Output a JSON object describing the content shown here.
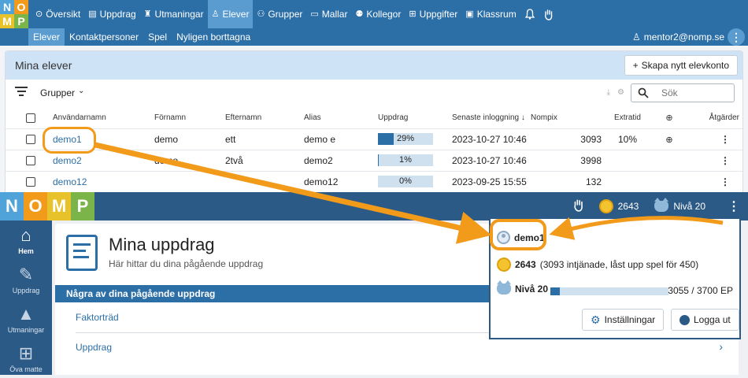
{
  "teacher": {
    "logo_letters": [
      "N",
      "O",
      "M",
      "P"
    ],
    "nav": [
      {
        "label": "Översikt",
        "icon": "compass-icon",
        "glyph": "⊙"
      },
      {
        "label": "Uppdrag",
        "icon": "book-icon",
        "glyph": "▤"
      },
      {
        "label": "Utmaningar",
        "icon": "trophy-icon",
        "glyph": "♜"
      },
      {
        "label": "Elever",
        "icon": "person-icon",
        "glyph": "♙"
      },
      {
        "label": "Grupper",
        "icon": "group-icon",
        "glyph": "⚇"
      },
      {
        "label": "Mallar",
        "icon": "folder-icon",
        "glyph": "▭"
      },
      {
        "label": "Kollegor",
        "icon": "colleagues-icon",
        "glyph": "⚉"
      },
      {
        "label": "Uppgifter",
        "icon": "grid-icon",
        "glyph": "⊞"
      },
      {
        "label": "Klassrum",
        "icon": "classroom-icon",
        "glyph": "▣"
      }
    ],
    "subnav": [
      "Elever",
      "Kontaktpersoner",
      "Spel",
      "Nyligen borttagna"
    ],
    "user_email": "mentor2@nomp.se",
    "card_title": "Mina elever",
    "create_button": "Skapa nytt elevkonto",
    "groups_label": "Grupper",
    "search_placeholder": "Sök",
    "columns": [
      "Användarnamn",
      "Förnamn",
      "Efternamn",
      "Alias",
      "Uppdrag",
      "Senaste inloggning",
      "Nompix",
      "Extratid",
      "Åtgärder"
    ],
    "rows": [
      {
        "username": "demo1",
        "first": "demo",
        "last": "ett",
        "alias": "demo e",
        "progress": "29%",
        "progress_value": 29,
        "login": "2023-10-27 10:46",
        "nompix": "3093",
        "extratid": "10%",
        "globe": true
      },
      {
        "username": "demo2",
        "first": "demo",
        "last": "2två",
        "alias": "demo2",
        "progress": "1%",
        "progress_value": 1,
        "login": "2023-10-27 10:46",
        "nompix": "3998",
        "extratid": "",
        "globe": false
      },
      {
        "username": "demo12",
        "first": "",
        "last": "",
        "alias": "demo12",
        "progress": "0%",
        "progress_value": 0,
        "login": "2023-09-25 15:55",
        "nompix": "132",
        "extratid": "",
        "globe": false
      }
    ]
  },
  "student": {
    "logo_letters": [
      "N",
      "O",
      "M",
      "P"
    ],
    "coins": "2643",
    "level": "Nivå 20",
    "sidebar": [
      {
        "label": "Hem",
        "icon": "home-icon",
        "glyph": "⌂"
      },
      {
        "label": "Uppdrag",
        "icon": "assignment-icon",
        "glyph": "✎"
      },
      {
        "label": "Utmaningar",
        "icon": "mountain-icon",
        "glyph": "▲"
      },
      {
        "label": "Öva matte",
        "icon": "calculator-icon",
        "glyph": "⊞"
      }
    ],
    "page_title": "Mina uppdrag",
    "page_subtitle": "Här hittar du dina pågående uppdrag",
    "section_header": "Några av dina pågående uppdrag",
    "assignments": [
      "Faktorträd",
      "Uppdrag"
    ]
  },
  "popup": {
    "username": "demo1",
    "coins_value": "2643",
    "coins_detail": "(3093 intjänade, låst upp spel för 450)",
    "level": "Nivå 20",
    "level_fraction": 0.08,
    "ep": "3055 / 3700 EP",
    "settings_button": "Inställningar",
    "logout_button": "Logga ut"
  },
  "colors": {
    "nav_blue": "#2c6ea6",
    "nav_dark": "#2c5a87",
    "active_tab": "#5a9bd0",
    "annotation_orange": "#f29a1a",
    "logo_n": "#4fa3d8",
    "logo_o": "#f29a1a",
    "logo_m": "#e8c22a",
    "logo_p": "#7bb449"
  }
}
